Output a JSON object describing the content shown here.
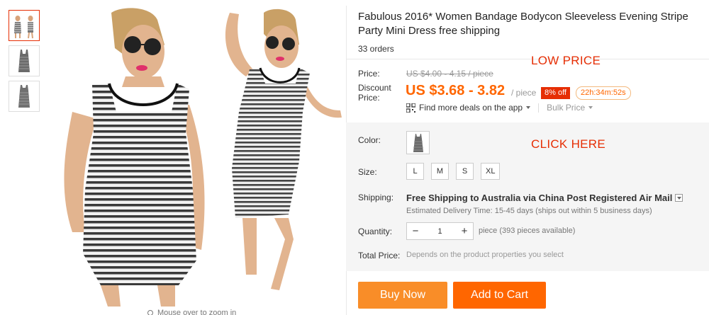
{
  "product": {
    "title": "Fabulous 2016* Women Bandage Bodycon Sleeveless Evening Stripe Party Mini Dress free shipping",
    "orders": "33 orders"
  },
  "gallery": {
    "zoom_hint": "Mouse over to zoom in",
    "thumbnails": [
      "thumb-1",
      "thumb-2",
      "thumb-3"
    ]
  },
  "price": {
    "price_label": "Price:",
    "original": "US $4.00 - 4.15 / piece",
    "discount_label_1": "Discount",
    "discount_label_2": "Price:",
    "discount_price": "US $3.68 - 3.82",
    "per_piece": "/ piece",
    "off_badge": "8% off",
    "timer": "22h:34m:52s",
    "deals_link": "Find more deals on the app",
    "bulk_price": "Bulk Price"
  },
  "annotations": {
    "low_price": "LOW PRICE",
    "click_here": "CLICK HERE"
  },
  "options": {
    "color_label": "Color:",
    "size_label": "Size:",
    "sizes": [
      "L",
      "M",
      "S",
      "XL"
    ],
    "shipping_label": "Shipping:",
    "shipping_main": "Free Shipping to Australia via China Post Registered Air Mail",
    "shipping_sub": "Estimated Delivery Time: 15-45 days (ships out within 5 business days)",
    "quantity_label": "Quantity:",
    "quantity_value": "1",
    "quantity_minus": "−",
    "quantity_plus": "+",
    "quantity_available": "piece (393 pieces available)",
    "total_label": "Total Price:",
    "total_note": "Depends on the product properties you select"
  },
  "actions": {
    "buy_now": "Buy Now",
    "add_to_cart": "Add to Cart"
  },
  "colors": {
    "accent_orange": "#ff6600",
    "buy_now_bg": "#f98d28",
    "badge_red": "#e62e04",
    "annotation_red": "#e62e04"
  }
}
